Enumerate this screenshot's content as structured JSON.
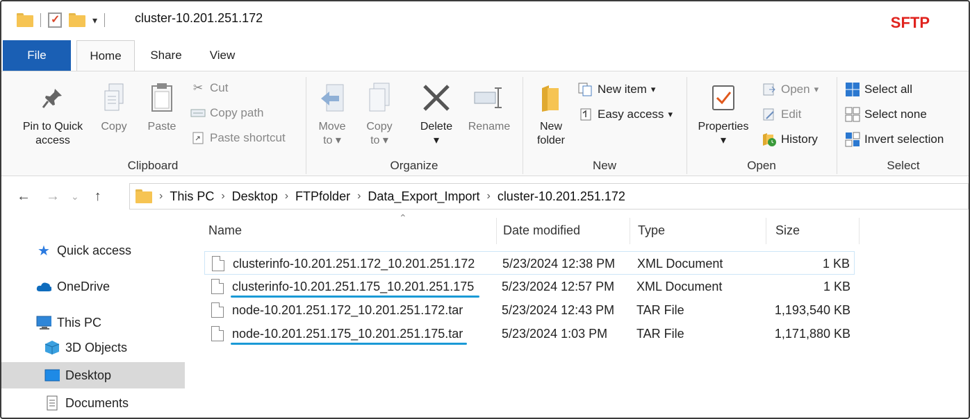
{
  "window": {
    "title": "cluster-10.201.251.172",
    "watermark": "SFTP",
    "accent": "#1a5fb4",
    "watermark_color": "#e0231e"
  },
  "tabs": [
    "File",
    "Home",
    "Share",
    "View"
  ],
  "ribbon": {
    "clipboard": {
      "label": "Clipboard",
      "pin": "Pin to Quick access",
      "pin_line1": "Pin to Quick",
      "pin_line2": "access",
      "copy": "Copy",
      "paste": "Paste",
      "cut": "Cut",
      "copy_path": "Copy path",
      "paste_shortcut": "Paste shortcut"
    },
    "organize": {
      "label": "Organize",
      "move_to": "Move",
      "move_to2": "to",
      "copy_to": "Copy",
      "copy_to2": "to",
      "delete": "Delete",
      "rename": "Rename"
    },
    "new": {
      "label": "New",
      "new_folder1": "New",
      "new_folder2": "folder",
      "new_item": "New item",
      "easy_access": "Easy access"
    },
    "open": {
      "label": "Open",
      "properties": "Properties",
      "open": "Open",
      "edit": "Edit",
      "history": "History"
    },
    "select": {
      "label": "Select",
      "select_all": "Select all",
      "select_none": "Select none",
      "invert": "Invert selection"
    }
  },
  "address": {
    "crumbs": [
      "This PC",
      "Desktop",
      "FTPfolder",
      "Data_Export_Import",
      "cluster-10.201.251.172"
    ]
  },
  "sidebar": {
    "items": [
      {
        "label": "Quick access",
        "icon": "star-icon"
      },
      {
        "label": "OneDrive",
        "icon": "cloud-icon"
      },
      {
        "label": "This PC",
        "icon": "monitor-icon"
      },
      {
        "label": "3D Objects",
        "icon": "cube-icon"
      },
      {
        "label": "Desktop",
        "icon": "desktop-icon"
      },
      {
        "label": "Documents",
        "icon": "document-icon"
      }
    ]
  },
  "columns": {
    "name": "Name",
    "date": "Date modified",
    "type": "Type",
    "size": "Size"
  },
  "files": [
    {
      "name": "clusterinfo-10.201.251.172_10.201.251.172",
      "date": "5/23/2024 12:38 PM",
      "type": "XML Document",
      "size": "1 KB"
    },
    {
      "name": "clusterinfo-10.201.251.175_10.201.251.175",
      "date": "5/23/2024 12:57 PM",
      "type": "XML Document",
      "size": "1 KB"
    },
    {
      "name": "node-10.201.251.172_10.201.251.172.tar",
      "date": "5/23/2024 12:43 PM",
      "type": "TAR File",
      "size": "1,193,540 KB"
    },
    {
      "name": "node-10.201.251.175_10.201.251.175.tar",
      "date": "5/23/2024 1:03 PM",
      "type": "TAR File",
      "size": "1,171,880 KB"
    }
  ]
}
